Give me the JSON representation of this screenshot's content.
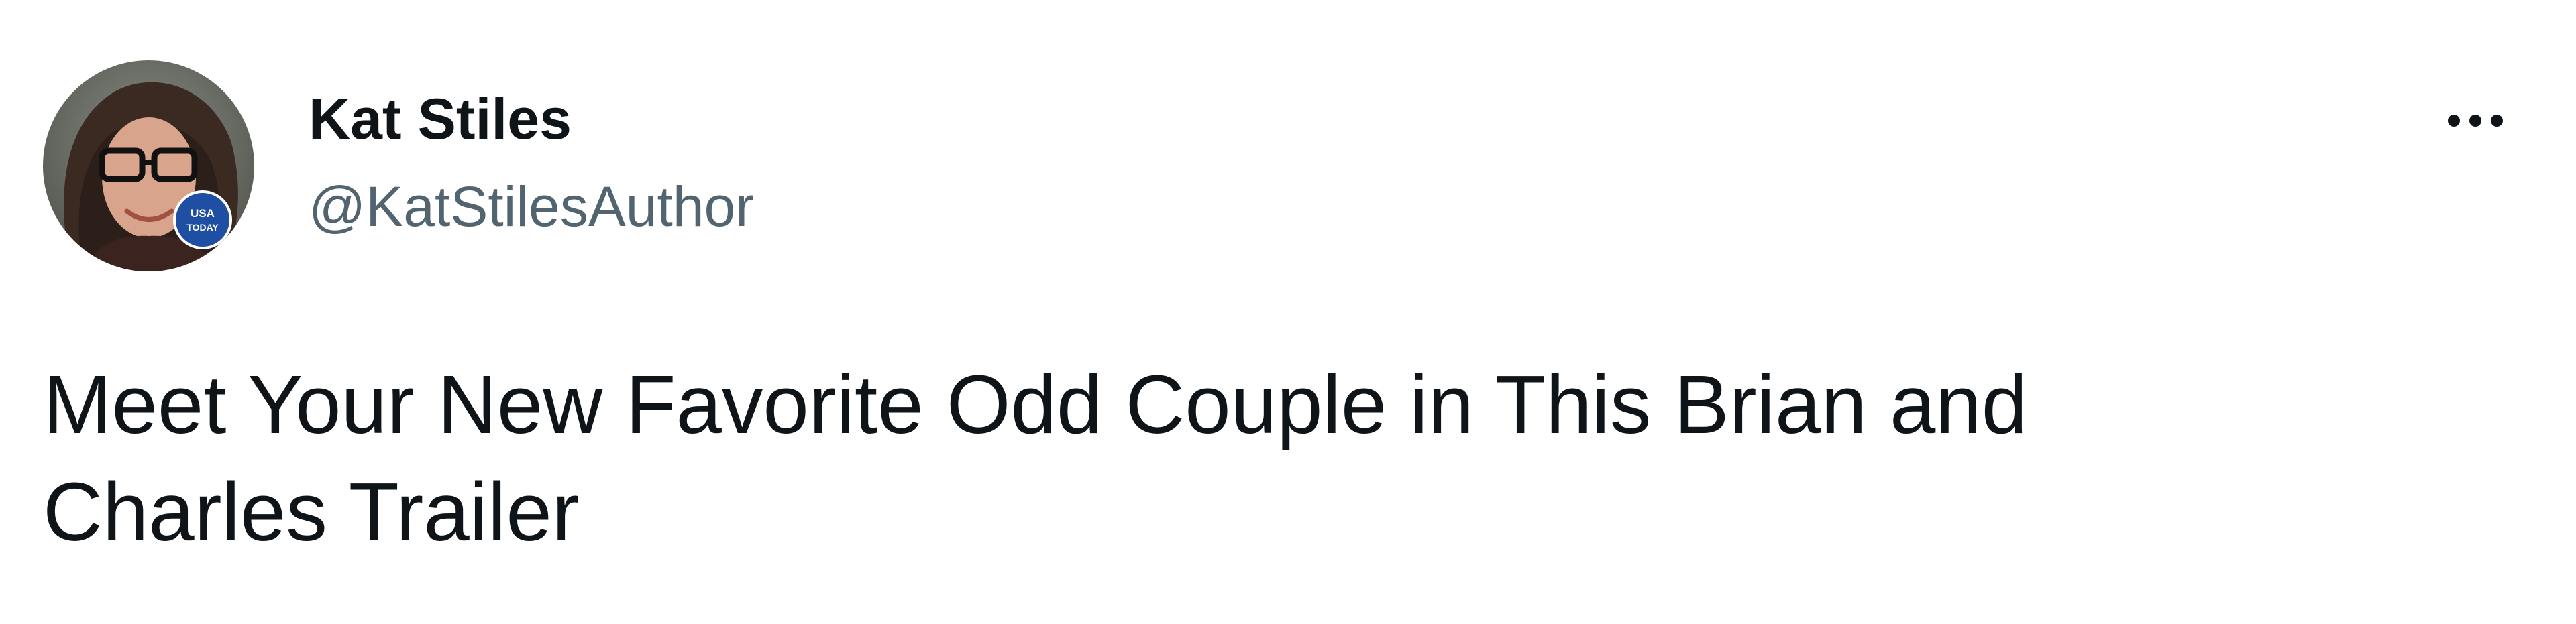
{
  "tweet": {
    "author": {
      "display_name": "Kat Stiles",
      "handle": "@KatStilesAuthor",
      "avatar_badge_text": "USA TODAY"
    },
    "menu_icon": "more-horizontal-icon",
    "text_lines": [
      "Meet Your New Favorite Odd Couple in This Brian and",
      "Charles Trailer"
    ]
  },
  "colors": {
    "text": "#0f1419",
    "secondary_text": "#536471",
    "background": "#ffffff",
    "badge": "#1f4fa3"
  }
}
